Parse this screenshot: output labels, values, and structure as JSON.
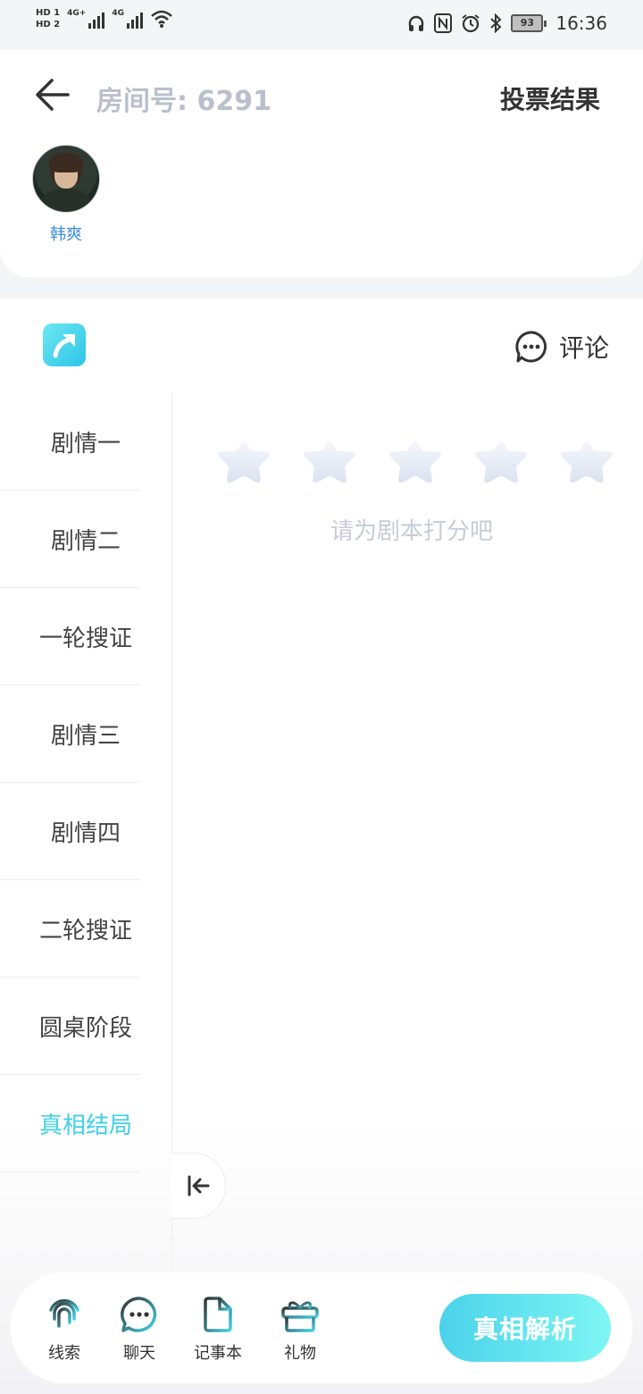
{
  "status_bar": {
    "hd1": "HD 1",
    "hd2": "HD 2",
    "net1": "4G+",
    "net2": "4G",
    "battery": "93",
    "time": "16:36"
  },
  "header": {
    "room_label": "房间号: 6291",
    "vote_result": "投票结果"
  },
  "player": {
    "name": "韩爽"
  },
  "panel": {
    "comment_label": "评论",
    "rate_hint": "请为剧本打分吧",
    "stars_total": 5,
    "stars_filled": 0
  },
  "nav": {
    "items": [
      {
        "label": "剧情一"
      },
      {
        "label": "剧情二"
      },
      {
        "label": "一轮搜证"
      },
      {
        "label": "剧情三"
      },
      {
        "label": "剧情四"
      },
      {
        "label": "二轮搜证"
      },
      {
        "label": "圆桌阶段"
      },
      {
        "label": "真相结局"
      }
    ],
    "active_index": 7
  },
  "bottom_bar": {
    "clues": "线索",
    "chat": "聊天",
    "notebook": "记事本",
    "gift": "礼物",
    "truth_button": "真相解析"
  },
  "colors": {
    "accent": "#3fd0e6",
    "muted": "#b9bfcc"
  }
}
